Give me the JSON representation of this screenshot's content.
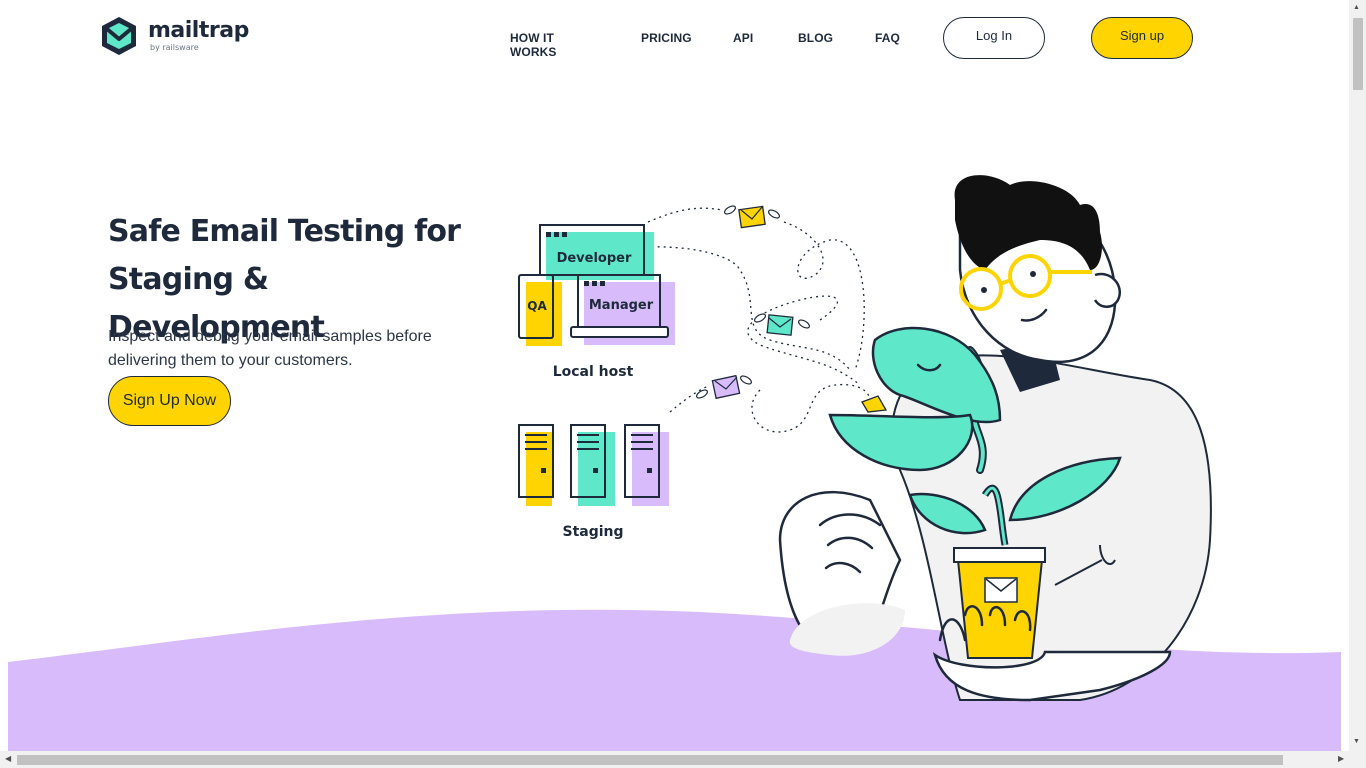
{
  "header": {
    "logo_word": "mailtrap",
    "logo_sub": "by railsware",
    "nav": {
      "how": "HOW IT WORKS",
      "pricing": "PRICING",
      "api": "API",
      "blog": "BLOG",
      "faq": "FAQ"
    },
    "login_label": "Log In",
    "signup_label": "Sign up"
  },
  "hero": {
    "title_line1": "Safe Email Testing for",
    "title_line2": "Staging & Development",
    "subtitle_line1": "Inspect and debug your email samples before",
    "subtitle_line2": "delivering them to your customers.",
    "cta_label": "Sign Up Now"
  },
  "illustration": {
    "developer": "Developer",
    "qa": "QA",
    "manager": "Manager",
    "local_host": "Local host",
    "staging": "Staging"
  },
  "colors": {
    "brand_teal": "#5ee7c8",
    "brand_yellow": "#ffd400",
    "lavender": "#d8bbfb",
    "dark": "#1e2a3b"
  }
}
